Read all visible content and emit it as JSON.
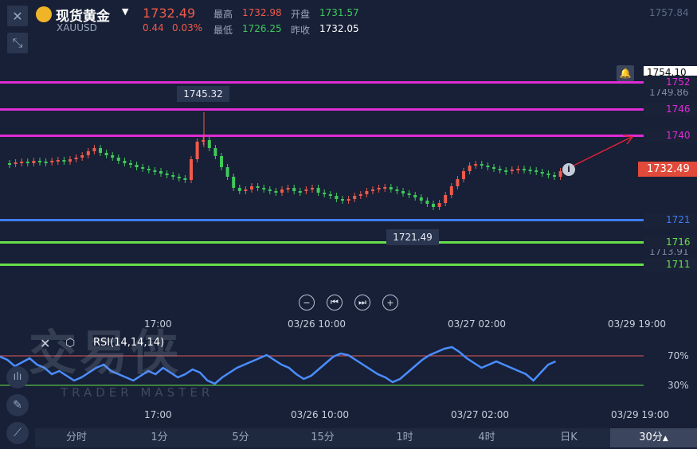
{
  "header": {
    "title": "现货黄金",
    "symbol": "XAUUSD",
    "price": "1732.49",
    "change": "0.44",
    "change_pct": "0.03%",
    "high_label": "最高",
    "high_value": "1732.98",
    "open_label": "开盘",
    "open_value": "1731.57",
    "low_label": "最低",
    "low_value": "1726.25",
    "prev_close_label": "昨收",
    "prev_close_value": "1732.05"
  },
  "axis": {
    "top_label": "1757.84",
    "alert_price": "1754.10",
    "tick_1": "1749.86",
    "tick_2": "1713.91",
    "current_price": "1732.49"
  },
  "levels": [
    {
      "value": "1752",
      "color": "#e02bd6"
    },
    {
      "value": "1746",
      "color": "#e02bd6"
    },
    {
      "value": "1740",
      "color": "#e02bd6"
    },
    {
      "value": "1721",
      "color": "#3f7cf0"
    },
    {
      "value": "1716",
      "color": "#67e04a"
    },
    {
      "value": "1711",
      "color": "#67e04a"
    }
  ],
  "annotations": {
    "high_marker": "1745.32",
    "low_marker": "1721.49"
  },
  "time_axis": [
    "17:00",
    "03/26 10:00",
    "03/27 02:00",
    "03/29 19:00"
  ],
  "rsi": {
    "label": "RSI(14,14,14)",
    "upper": "70%",
    "lower": "30%"
  },
  "watermark": {
    "line1": "交易侠",
    "line2": "TRADER MASTER"
  },
  "timeframes": [
    "分时",
    "1分",
    "5分",
    "15分",
    "1时",
    "4时",
    "日K",
    "30分"
  ],
  "active_timeframe_marker": "▲",
  "colors": {
    "background": "#172036",
    "up": "#f05a4a",
    "down": "#3fc95a",
    "rsi_line": "#4a8dff"
  },
  "icons": [
    "close-icon",
    "gold-coin-icon",
    "dropdown-icon",
    "collapse-icon",
    "bell-icon",
    "info-icon",
    "zoom-out-icon",
    "step-back-icon",
    "step-forward-icon",
    "zoom-in-icon",
    "indicator-icon",
    "draw-line-icon",
    "trend-icon"
  ]
}
